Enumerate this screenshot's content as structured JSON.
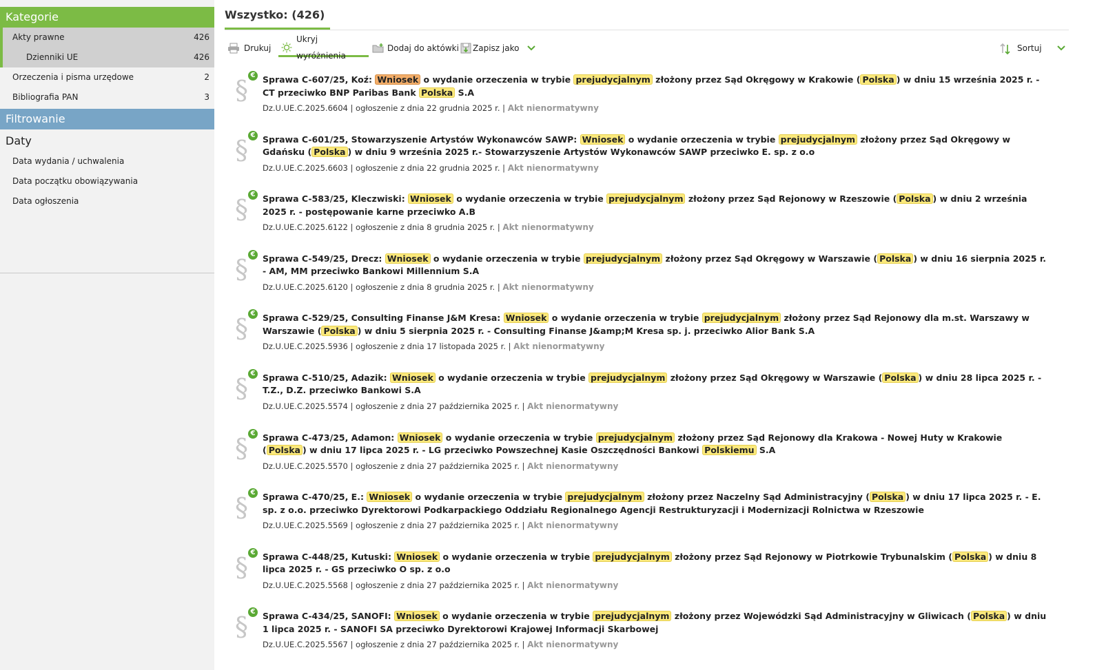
{
  "sidebar": {
    "categories_header": "Kategorie",
    "items": [
      {
        "label": "Akty prawne",
        "count": "426"
      },
      {
        "label": "Dzienniki UE",
        "count": "426"
      },
      {
        "label": "Orzeczenia i pisma urzędowe",
        "count": "2"
      },
      {
        "label": "Bibliografia PAN",
        "count": "3"
      }
    ],
    "filter_header": "Filtrowanie",
    "dates_title": "Daty",
    "date_filters": [
      "Data wydania / uchwalenia",
      "Data początku obowiązywania",
      "Data ogłoszenia"
    ]
  },
  "main": {
    "title": "Wszystko: (426)",
    "toolbar": {
      "print": "Drukuj",
      "hide_highlights": "Ukryj wyróżnienia",
      "add_to_folder": "Dodaj do aktówki",
      "save_as": "Zapisz jako",
      "sort": "Sortuj"
    }
  },
  "results": [
    {
      "t": [
        "Sprawa C-607/25, Koź: ",
        "Wniosek",
        " o wydanie orzeczenia w trybie ",
        "prejudycjalnym",
        " złożony przez Sąd Okręgowy w Krakowie (",
        "Polska",
        ") w dniu 15 września 2025 r. - CT przeciwko BNP Paribas Bank ",
        "Polska",
        " S.A"
      ],
      "orange": true,
      "id": "Dz.U.UE.C.2025.6604",
      "date": "ogłoszenie z dnia 22 grudnia 2025 r.",
      "status": "Akt nienormatywny"
    },
    {
      "t": [
        "Sprawa C-601/25, Stowarzyszenie Artystów Wykonawców SAWP: ",
        "Wniosek",
        " o wydanie orzeczenia w trybie ",
        "prejudycjalnym",
        " złożony przez Sąd Okręgowy w Gdańsku (",
        "Polska",
        ") w dniu 9 września 2025 r.- Stowarzyszenie Artystów Wykonawców SAWP przeciwko E. sp. z o.o"
      ],
      "id": "Dz.U.UE.C.2025.6603",
      "date": "ogłoszenie z dnia 22 grudnia 2025 r.",
      "status": "Akt nienormatywny"
    },
    {
      "t": [
        "Sprawa C-583/25, Kleczwiski: ",
        "Wniosek",
        " o wydanie orzeczenia w trybie ",
        "prejudycjalnym",
        " złożony przez Sąd Rejonowy w Rzeszowie (",
        "Polska",
        ") w dniu 2 września 2025 r. - postępowanie karne przeciwko A.B"
      ],
      "id": "Dz.U.UE.C.2025.6122",
      "date": "ogłoszenie z dnia 8 grudnia 2025 r.",
      "status": "Akt nienormatywny"
    },
    {
      "t": [
        "Sprawa C-549/25, Drecz: ",
        "Wniosek",
        " o wydanie orzeczenia w trybie ",
        "prejudycjalnym",
        " złożony przez Sąd Okręgowy w Warszawie (",
        "Polska",
        ") w dniu 16 sierpnia 2025 r. - AM, MM przeciwko Bankowi Millennium S.A"
      ],
      "id": "Dz.U.UE.C.2025.6120",
      "date": "ogłoszenie z dnia 8 grudnia 2025 r.",
      "status": "Akt nienormatywny"
    },
    {
      "t": [
        "Sprawa C-529/25, Consulting Finanse J&M Kresa: ",
        "Wniosek",
        " o wydanie orzeczenia w trybie ",
        "prejudycjalnym",
        " złożony przez Sąd Rejonowy dla m.st. Warszawy w Warszawie (",
        "Polska",
        ") w dniu 5 sierpnia 2025 r. - Consulting Finanse J&amp;M Kresa sp. j. przeciwko Alior Bank S.A"
      ],
      "id": "Dz.U.UE.C.2025.5936",
      "date": "ogłoszenie z dnia 17 listopada 2025 r.",
      "status": "Akt nienormatywny"
    },
    {
      "t": [
        "Sprawa C-510/25, Adazik: ",
        "Wniosek",
        " o wydanie orzeczenia w trybie ",
        "prejudycjalnym",
        " złożony przez Sąd Okręgowy w Warszawie (",
        "Polska",
        ") w dniu 28 lipca 2025 r. - T.Z., D.Z. przeciwko Bankowi S.A"
      ],
      "id": "Dz.U.UE.C.2025.5574",
      "date": "ogłoszenie z dnia 27 października 2025 r.",
      "status": "Akt nienormatywny"
    },
    {
      "t": [
        "Sprawa C-473/25, Adamon: ",
        "Wniosek",
        " o wydanie orzeczenia w trybie ",
        "prejudycjalnym",
        " złożony przez Sąd Rejonowy dla Krakowa - Nowej Huty w Krakowie (",
        "Polska",
        ") w dniu 17 lipca 2025 r. - LG przeciwko Powszechnej Kasie Oszczędności Bankowi ",
        "Polskiemu",
        " S.A"
      ],
      "id": "Dz.U.UE.C.2025.5570",
      "date": "ogłoszenie z dnia 27 października 2025 r.",
      "status": "Akt nienormatywny"
    },
    {
      "t": [
        "Sprawa C-470/25, E.: ",
        "Wniosek",
        " o wydanie orzeczenia w trybie ",
        "prejudycjalnym",
        " złożony przez Naczelny Sąd Administracyjny (",
        "Polska",
        ") w dniu 17 lipca 2025 r. - E. sp. z o.o. przeciwko Dyrektorowi Podkarpackiego Oddziału Regionalnego Agencji Restrukturyzacji i Modernizacji Rolnictwa w Rzeszowie"
      ],
      "id": "Dz.U.UE.C.2025.5569",
      "date": "ogłoszenie z dnia 27 października 2025 r.",
      "status": "Akt nienormatywny"
    },
    {
      "t": [
        "Sprawa C-448/25, Kutuski: ",
        "Wniosek",
        " o wydanie orzeczenia w trybie ",
        "prejudycjalnym",
        " złożony przez Sąd Rejonowy w Piotrkowie Trybunalskim (",
        "Polska",
        ") w dniu 8 lipca 2025 r. - GS przeciwko O sp. z o.o"
      ],
      "id": "Dz.U.UE.C.2025.5568",
      "date": "ogłoszenie z dnia 27 października 2025 r.",
      "status": "Akt nienormatywny"
    },
    {
      "t": [
        "Sprawa C-434/25, SANOFI: ",
        "Wniosek",
        " o wydanie orzeczenia w trybie ",
        "prejudycjalnym",
        " złożony przez Wojewódzki Sąd Administracyjny w Gliwicach (",
        "Polska",
        ") w dniu 1 lipca 2025 r. - SANOFI SA przeciwko Dyrektorowi Krajowej Informacji Skarbowej"
      ],
      "id": "Dz.U.UE.C.2025.5567",
      "date": "ogłoszenie z dnia 27 października 2025 r.",
      "status": "Akt nienormatywny"
    }
  ],
  "colors": {
    "accent_green": "#7cbb45",
    "filter_blue": "#78a5c6",
    "highlight_yellow": "#fbe97c",
    "highlight_orange": "#f3ae6a",
    "euro_green": "#5aa934"
  },
  "icons": {
    "print": "printer-icon",
    "hide_highlights": "sun-icon",
    "add_to_folder": "folder-icon",
    "save_as": "save-icon",
    "sort": "sort-arrows-icon",
    "result": "paragraph-icon",
    "euro": "euro-icon"
  }
}
